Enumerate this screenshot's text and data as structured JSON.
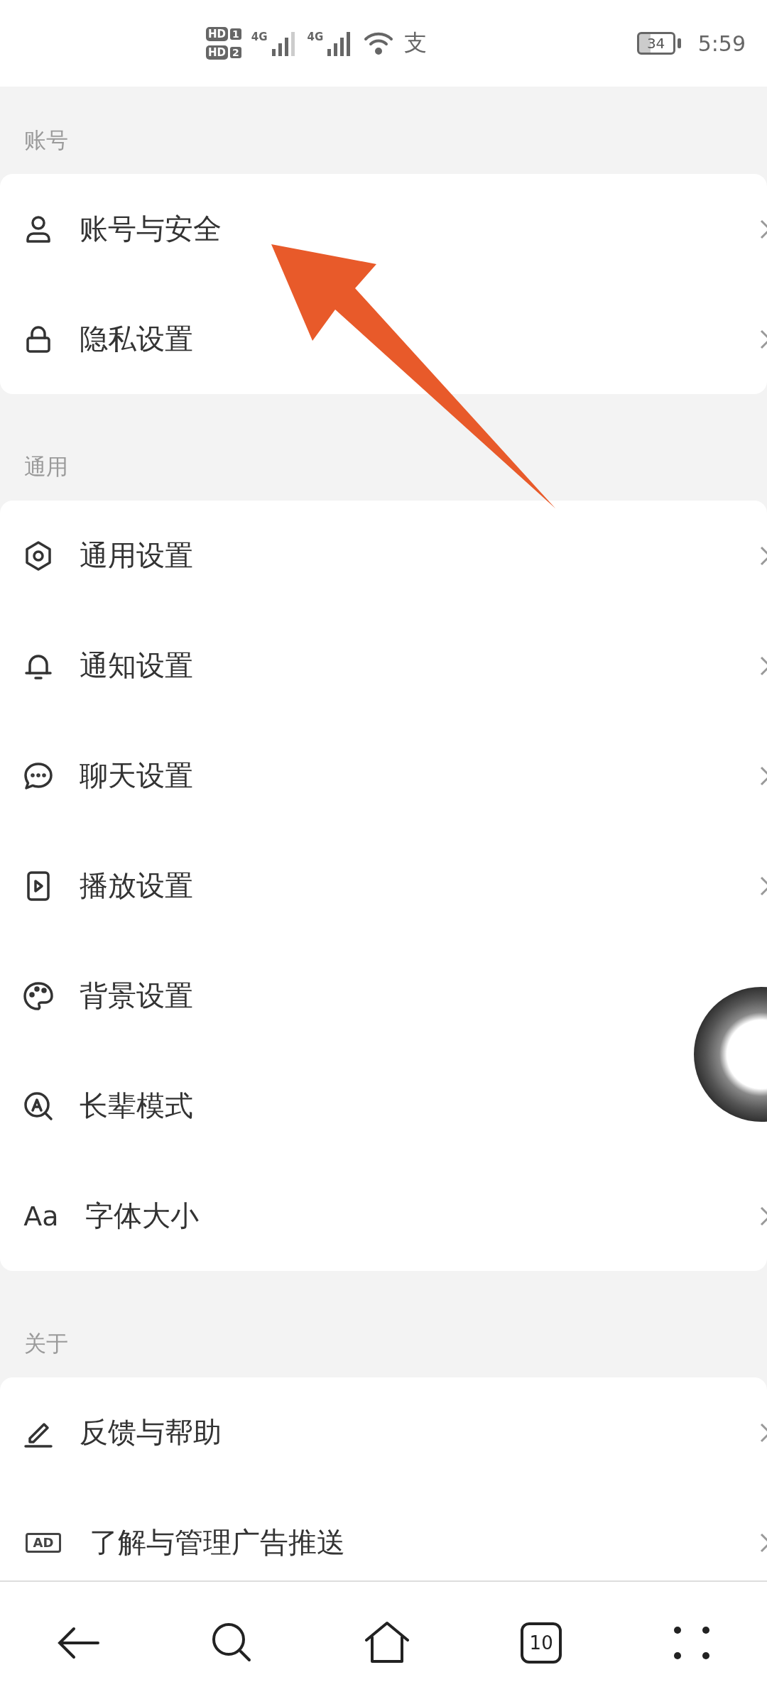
{
  "status_bar": {
    "sims": [
      {
        "label": "HD",
        "slot": "1"
      },
      {
        "label": "HD",
        "slot": "2"
      }
    ],
    "networks": [
      "4G",
      "4G"
    ],
    "notification": "支",
    "battery": "34",
    "time": "5:59"
  },
  "sections": [
    {
      "title": "账号",
      "items": [
        {
          "kind": "person",
          "label": "账号与安全",
          "chevron": true
        },
        {
          "kind": "lock",
          "label": "隐私设置",
          "chevron": true
        }
      ]
    },
    {
      "title": "通用",
      "items": [
        {
          "kind": "gear",
          "label": "通用设置",
          "chevron": true
        },
        {
          "kind": "bell",
          "label": "通知设置",
          "chevron": true
        },
        {
          "kind": "chat",
          "label": "聊天设置",
          "chevron": true
        },
        {
          "kind": "play",
          "label": "播放设置",
          "chevron": true
        },
        {
          "kind": "palette",
          "label": "背景设置",
          "chevron": false
        },
        {
          "kind": "elder",
          "label": "长辈模式",
          "chevron": false
        },
        {
          "kind": "text",
          "icon_text": "Aa",
          "label": "字体大小",
          "chevron": true
        }
      ]
    },
    {
      "title": "关于",
      "items": [
        {
          "kind": "pen",
          "label": "反馈与帮助",
          "chevron": true
        },
        {
          "kind": "boxtext",
          "icon_text": "AD",
          "label": "了解与管理广告推送",
          "chevron": true
        }
      ]
    }
  ],
  "nav": {
    "tabs_count": "10"
  }
}
